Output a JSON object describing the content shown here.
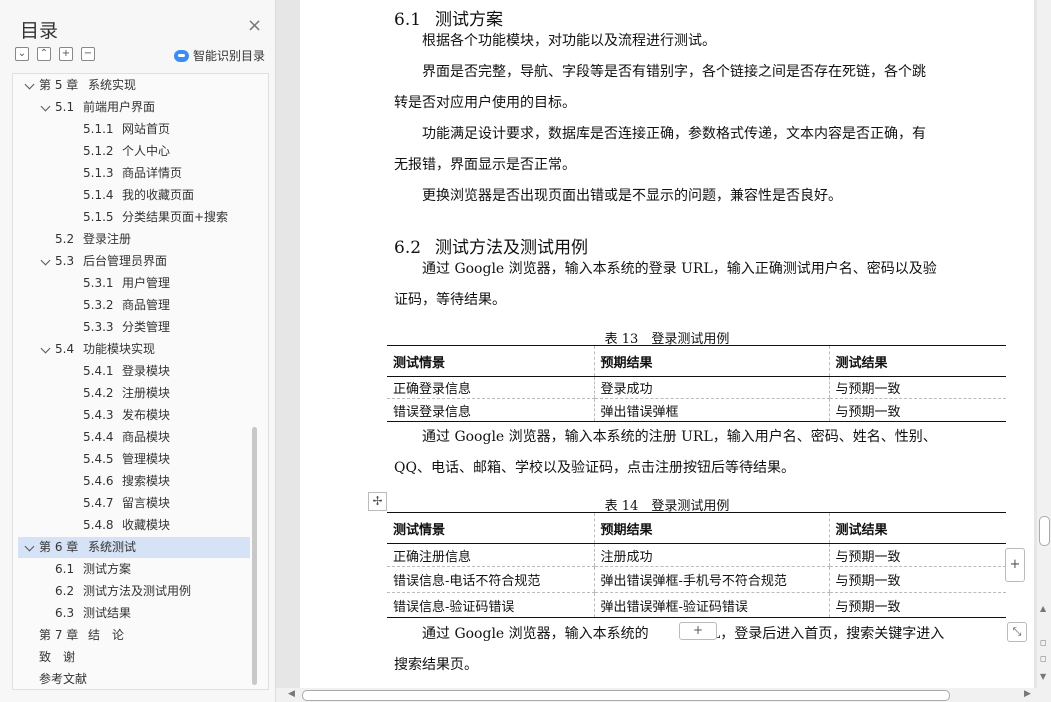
{
  "sidebar": {
    "title": "目录",
    "close_icon": "×",
    "tools": [
      "⌄",
      "⌃",
      "+",
      "−"
    ],
    "smart_toc_label": "智能识别目录",
    "toc": [
      {
        "num": "第 5 章",
        "label": "系统实现",
        "level": 0,
        "caret": true
      },
      {
        "num": "5.1",
        "label": "前端用户界面",
        "level": 1,
        "caret": true
      },
      {
        "num": "5.1.1",
        "label": "网站首页",
        "level": 2
      },
      {
        "num": "5.1.2",
        "label": "个人中心",
        "level": 2
      },
      {
        "num": "5.1.3",
        "label": "商品详情页",
        "level": 2
      },
      {
        "num": "5.1.4",
        "label": "我的收藏页面",
        "level": 2
      },
      {
        "num": "5.1.5",
        "label": "分类结果页面+搜索",
        "level": 2
      },
      {
        "num": "5.2",
        "label": "登录注册",
        "level": 1
      },
      {
        "num": "5.3",
        "label": "后台管理员界面",
        "level": 1,
        "caret": true
      },
      {
        "num": "5.3.1",
        "label": "用户管理",
        "level": 2
      },
      {
        "num": "5.3.2",
        "label": "商品管理",
        "level": 2
      },
      {
        "num": "5.3.3",
        "label": "分类管理",
        "level": 2
      },
      {
        "num": "5.4",
        "label": "功能模块实现",
        "level": 1,
        "caret": true
      },
      {
        "num": "5.4.1",
        "label": "登录模块",
        "level": 2
      },
      {
        "num": "5.4.2",
        "label": "注册模块",
        "level": 2
      },
      {
        "num": "5.4.3",
        "label": "发布模块",
        "level": 2
      },
      {
        "num": "5.4.4",
        "label": "商品模块",
        "level": 2
      },
      {
        "num": "5.4.5",
        "label": "管理模块",
        "level": 2
      },
      {
        "num": "5.4.6",
        "label": "搜索模块",
        "level": 2
      },
      {
        "num": "5.4.7",
        "label": "留言模块",
        "level": 2
      },
      {
        "num": "5.4.8",
        "label": "收藏模块",
        "level": 2
      },
      {
        "num": "第 6 章",
        "label": "系统测试",
        "level": 0,
        "caret": true,
        "active": true
      },
      {
        "num": "6.1",
        "label": "测试方案",
        "level": 1
      },
      {
        "num": "6.2",
        "label": "测试方法及测试用例",
        "level": 1
      },
      {
        "num": "6.3",
        "label": "测试结果",
        "level": 1
      },
      {
        "num": "第 7 章",
        "label": "结　论",
        "level": 0
      },
      {
        "num": "致　谢",
        "label": "",
        "level": 0
      },
      {
        "num": "参考文献",
        "label": "",
        "level": 0
      }
    ]
  },
  "document": {
    "h61": {
      "num": "6.1",
      "title": "测试方案"
    },
    "p1": "根据各个功能模块，对功能以及流程进行测试。",
    "p2a": "界面是否完整，导航、字段等是否有错别字，各个链接之间是否存在死链，各个跳",
    "p2b": "转是否对应用户使用的目标。",
    "p3a": "功能满足设计要求，数据库是否连接正确，参数格式传递，文本内容是否正确，有",
    "p3b": "无报错，界面显示是否正常。",
    "p4": "更换浏览器是否出现页面出错或是不显示的问题，兼容性是否良好。",
    "h62": {
      "num": "6.2",
      "title": "测试方法及测试用例"
    },
    "p5a": "通过 Google 浏览器，输入本系统的登录 URL，输入正确测试用户名、密码以及验",
    "p5b": "证码，等待结果。",
    "table13": {
      "caption": "表 13　登录测试用例",
      "headers": [
        "测试情景",
        "预期结果",
        "测试结果"
      ],
      "rows": [
        [
          "正确登录信息",
          "登录成功",
          "与预期一致"
        ],
        [
          "错误登录信息",
          "弹出错误弹框",
          "与预期一致"
        ]
      ]
    },
    "p6a": "通过 Google 浏览器，输入本系统的注册 URL，输入用户名、密码、姓名、性别、",
    "p6b": "QQ、电话、邮箱、学校以及验证码，点击注册按钮后等待结果。",
    "table14": {
      "caption": "表 14　登录测试用例",
      "headers": [
        "测试情景",
        "预期结果",
        "测试结果"
      ],
      "rows": [
        [
          "正确注册信息",
          "注册成功",
          "与预期一致"
        ],
        [
          "错误信息-电话不符合规范",
          "弹出错误弹框-手机号不符合规范",
          "与预期一致"
        ],
        [
          "错误信息-验证码错误",
          "弹出错误弹框-验证码错误",
          "与预期一致"
        ]
      ]
    },
    "p7a_start": "通过 Google 浏览器，输入本系统的",
    "p7a_end": "URL，登录后进入首页，搜索关键字进入",
    "p7b": "搜索结果页。",
    "handles": {
      "move": "✢",
      "add_row": "+",
      "add_col": "+",
      "resize": "⤡"
    }
  }
}
